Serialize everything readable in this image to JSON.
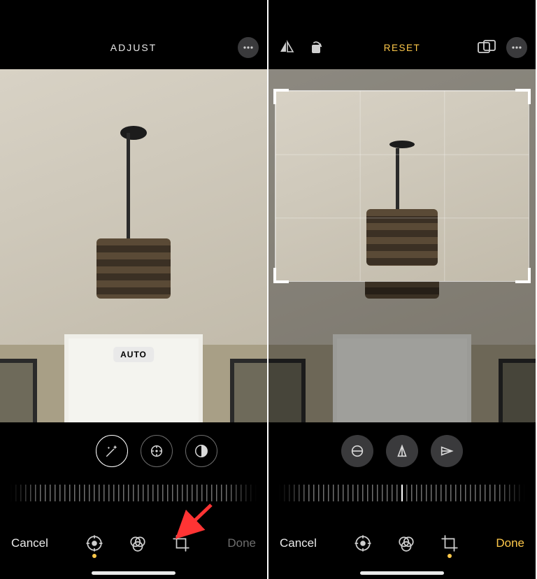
{
  "left": {
    "title": "ADJUST",
    "auto_pill": "AUTO",
    "cancel": "Cancel",
    "done": "Done",
    "done_active": false,
    "tools": {
      "magic": "auto-enhance",
      "exposure": "exposure",
      "contrast": "contrast"
    },
    "bottom_icons": {
      "adjust": "adjust",
      "filters": "filters",
      "crop": "crop"
    }
  },
  "right": {
    "title": "RESET",
    "cancel": "Cancel",
    "done": "Done",
    "done_active": true,
    "top_tools": {
      "flip": "flip",
      "rotate": "rotate",
      "aspect": "aspect-ratio",
      "more": "more"
    },
    "bottom_icons": {
      "adjust": "adjust",
      "filters": "filters",
      "crop": "crop"
    }
  }
}
